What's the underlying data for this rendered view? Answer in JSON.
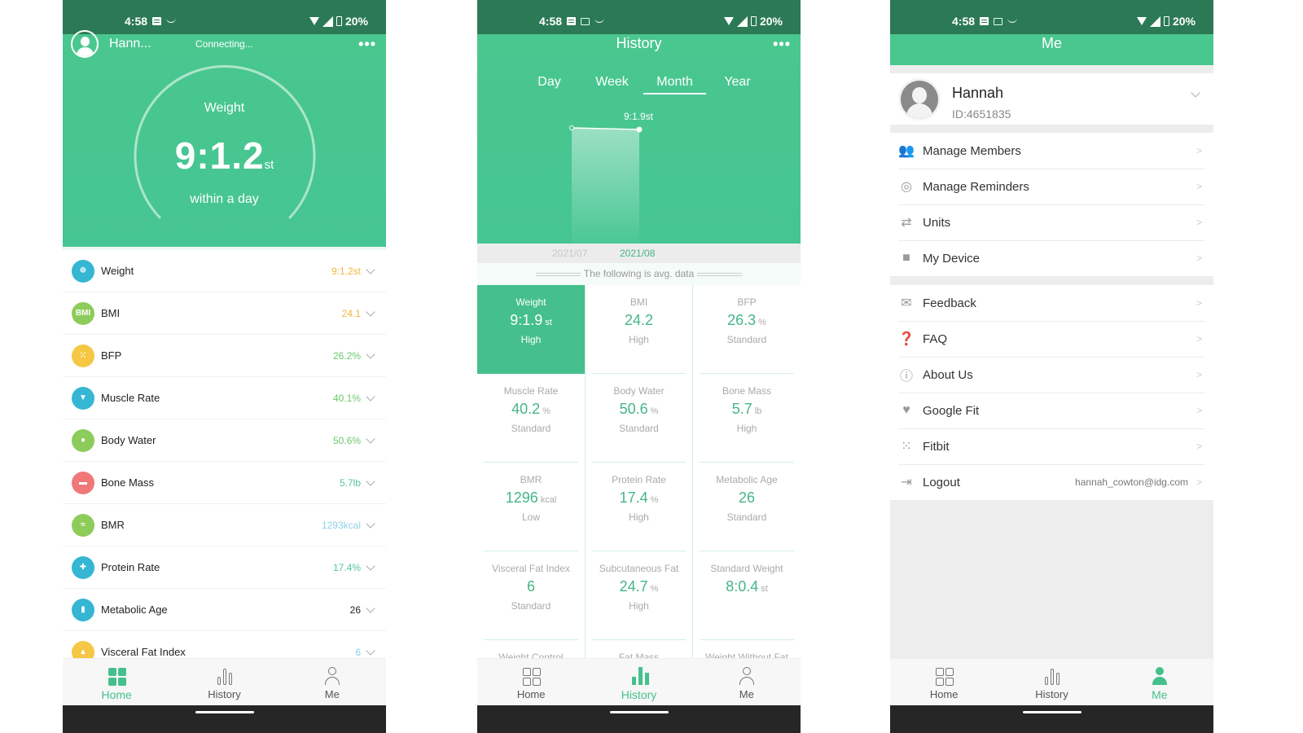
{
  "status_bar": {
    "time": "4:58",
    "battery": "20%"
  },
  "home": {
    "user_name": "Hann...",
    "connection_status": "Connecting...",
    "more_icon": "more-dots-icon",
    "hero": {
      "label": "Weight",
      "value": "9:1.2",
      "unit": "st",
      "subtitle": "within a day"
    },
    "metrics": [
      {
        "label": "Weight",
        "value": "9:1.2st",
        "icon": "feet-icon",
        "icon_color": "#35b6d3",
        "value_color": "#f0b63b"
      },
      {
        "label": "BMI",
        "value": "24.1",
        "icon": "bmi-icon",
        "icon_text": "BMI",
        "icon_color": "#8dcc5a",
        "value_color": "#f0b63b"
      },
      {
        "label": "BFP",
        "value": "26.2%",
        "icon": "fat-cells-icon",
        "icon_color": "#f6c744",
        "value_color": "#6cc86a"
      },
      {
        "label": "Muscle Rate",
        "value": "40.1%",
        "icon": "muscle-icon",
        "icon_color": "#35b6d3",
        "value_color": "#6cc86a"
      },
      {
        "label": "Body Water",
        "value": "50.6%",
        "icon": "water-drop-icon",
        "icon_color": "#8dcc5a",
        "value_color": "#6cc86a"
      },
      {
        "label": "Bone Mass",
        "value": "5.7lb",
        "icon": "bone-icon",
        "icon_color": "#f07878",
        "value_color": "#55c3a0"
      },
      {
        "label": "BMR",
        "value": "1293kcal",
        "icon": "heat-icon",
        "icon_color": "#8dcc5a",
        "value_color": "#8ed0e6"
      },
      {
        "label": "Protein Rate",
        "value": "17.4%",
        "icon": "protein-icon",
        "icon_color": "#35b6d3",
        "value_color": "#55c3a0"
      },
      {
        "label": "Metabolic Age",
        "value": "26",
        "icon": "body-icon",
        "icon_color": "#35b6d3",
        "value_color": "#222222"
      },
      {
        "label": "Visceral Fat Index",
        "value": "6",
        "icon": "lungs-icon",
        "icon_color": "#f6c744",
        "value_color": "#8ed0e6"
      }
    ]
  },
  "history": {
    "title": "History",
    "period_tabs": [
      "Day",
      "Week",
      "Month",
      "Year"
    ],
    "active_period": "Month",
    "chart_label": "9:1.9st",
    "dates": [
      "2021/07",
      "2021/08"
    ],
    "active_date": "2021/08",
    "avg_note": "The following is avg. data",
    "cards": [
      {
        "title": "Weight",
        "value": "9:1.9",
        "unit": "st",
        "status": "High",
        "active": true
      },
      {
        "title": "BMI",
        "value": "24.2",
        "unit": "",
        "status": "High"
      },
      {
        "title": "BFP",
        "value": "26.3",
        "unit": "%",
        "status": "Standard"
      },
      {
        "title": "Muscle Rate",
        "value": "40.2",
        "unit": "%",
        "status": "Standard"
      },
      {
        "title": "Body Water",
        "value": "50.6",
        "unit": "%",
        "status": "Standard"
      },
      {
        "title": "Bone Mass",
        "value": "5.7",
        "unit": "lb",
        "status": "High"
      },
      {
        "title": "BMR",
        "value": "1296",
        "unit": "kcal",
        "status": "Low"
      },
      {
        "title": "Protein Rate",
        "value": "17.4",
        "unit": "%",
        "status": "High"
      },
      {
        "title": "Metabolic Age",
        "value": "26",
        "unit": "",
        "status": "Standard"
      },
      {
        "title": "Visceral Fat Index",
        "value": "6",
        "unit": "",
        "status": "Standard"
      },
      {
        "title": "Subcutaneous Fat",
        "value": "24.7",
        "unit": "%",
        "status": "High"
      },
      {
        "title": "Standard Weight",
        "value": "8:0.4",
        "unit": "st",
        "status": ""
      },
      {
        "title": "Weight Control",
        "value": "",
        "unit": "",
        "status": ""
      },
      {
        "title": "Fat Mass",
        "value": "",
        "unit": "",
        "status": ""
      },
      {
        "title": "Weight Without Fat",
        "value": "",
        "unit": "",
        "status": ""
      }
    ]
  },
  "me": {
    "title": "Me",
    "profile": {
      "name": "Hannah",
      "id": "ID:4651835"
    },
    "group1": [
      {
        "label": "Manage Members",
        "icon": "members-icon"
      },
      {
        "label": "Manage Reminders",
        "icon": "alarm-icon"
      },
      {
        "label": "Units",
        "icon": "swap-arrows-icon"
      },
      {
        "label": "My Device",
        "icon": "device-icon"
      }
    ],
    "group2": [
      {
        "label": "Feedback",
        "icon": "mail-icon"
      },
      {
        "label": "FAQ",
        "icon": "question-icon"
      },
      {
        "label": "About Us",
        "icon": "info-icon"
      },
      {
        "label": "Google Fit",
        "icon": "heart-icon"
      },
      {
        "label": "Fitbit",
        "icon": "fitbit-icon"
      },
      {
        "label": "Logout",
        "icon": "logout-icon",
        "extra": "hannah_cowton@idg.com"
      }
    ],
    "arrow": ">"
  },
  "tabbar": {
    "home": "Home",
    "history": "History",
    "me": "Me"
  },
  "colors": {
    "accent": "#45c08c",
    "status_bar": "#2c7a55"
  }
}
